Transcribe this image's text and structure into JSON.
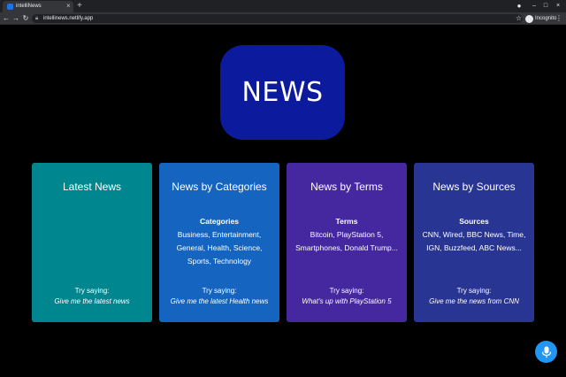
{
  "browser": {
    "tab_title": "intelliNews",
    "url": "intellinews.netlify.app",
    "profile_label": "Incognito"
  },
  "logo": {
    "text": "NEWS",
    "color": "#0c1b9d"
  },
  "cards": [
    {
      "title": "Latest News",
      "heading": "",
      "description": "",
      "hint_label": "Try saying:",
      "hint_example": "Give me the latest news",
      "color": "#00868f"
    },
    {
      "title": "News by Categories",
      "heading": "Categories",
      "description": "Business, Entertainment, General, Health, Science, Sports, Technology",
      "hint_label": "Try saying:",
      "hint_example": "Give me the latest Health news",
      "color": "#1565c0"
    },
    {
      "title": "News by Terms",
      "heading": "Terms",
      "description": "Bitcoin, PlayStation 5, Smartphones, Donald Trump...",
      "hint_label": "Try saying:",
      "hint_example": "What's up with PlayStation 5",
      "color": "#4527a0"
    },
    {
      "title": "News by Sources",
      "heading": "Sources",
      "description": "CNN, Wired, BBC News, Time, IGN, Buzzfeed, ABC News...",
      "hint_label": "Try saying:",
      "hint_example": "Give me the news from CNN",
      "color": "#283593"
    }
  ],
  "mic": {
    "icon": "microphone-icon",
    "color": "#2196f3"
  }
}
